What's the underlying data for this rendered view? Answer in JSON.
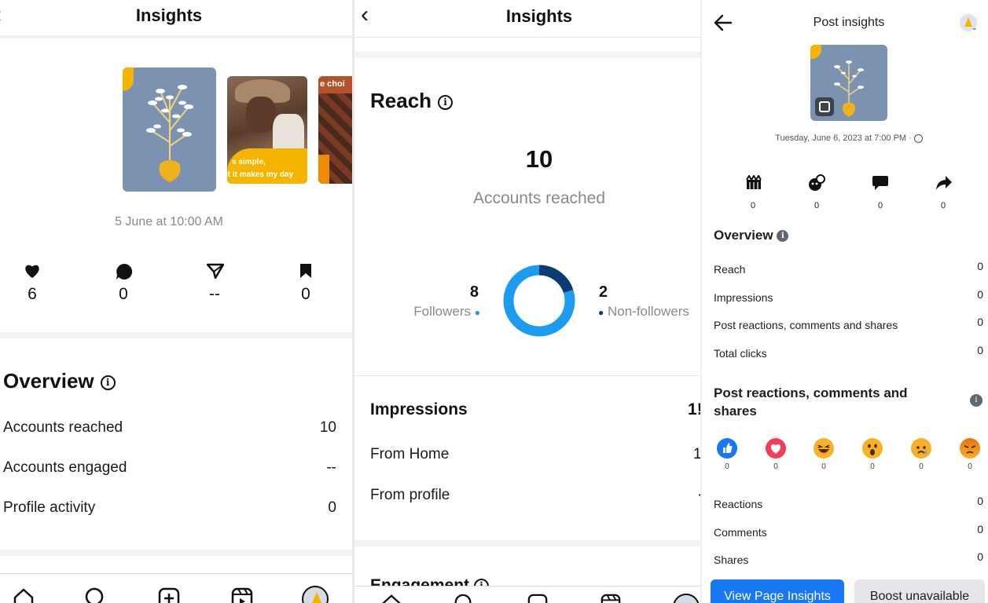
{
  "panel1": {
    "title": "Insights",
    "thumb_text_1": "e choi",
    "thumb_text_2": "s simple,",
    "thumb_text_3": "it it makes my day",
    "date": "5 June at 10:00 AM",
    "stats": [
      {
        "icon": "heart-icon",
        "value": "6"
      },
      {
        "icon": "comment-icon",
        "value": "0"
      },
      {
        "icon": "send-icon",
        "value": "--"
      },
      {
        "icon": "bookmark-icon",
        "value": "0"
      }
    ],
    "overview_title": "Overview",
    "rows": [
      {
        "label": "Accounts reached",
        "value": "10"
      },
      {
        "label": "Accounts engaged",
        "value": "--"
      },
      {
        "label": "Profile activity",
        "value": "0"
      }
    ],
    "nav": [
      "home-icon",
      "search-icon",
      "create-icon",
      "reels-icon",
      "profile-avatar"
    ]
  },
  "panel2": {
    "title": "Insights",
    "reach_title": "Reach",
    "reach_value": "10",
    "reach_caption": "Accounts reached",
    "followers_value": "8",
    "followers_label": "Followers",
    "nonfollowers_value": "2",
    "nonfollowers_label": "Non-followers",
    "donut": {
      "followers": 8,
      "nonfollowers": 2,
      "followers_color": "#1d9bf0",
      "nonfollowers_color": "#0c3a73"
    },
    "impressions_title": "Impressions",
    "impressions_value": "1!",
    "impr_rows": [
      {
        "label": "From Home",
        "value": "1"
      },
      {
        "label": "From profile",
        "value": "·"
      }
    ],
    "engagement_title": "Engagement"
  },
  "panel3": {
    "title": "Post insights",
    "date": "Tuesday, June 6, 2023 at 7:00 PM · ",
    "actions": [
      {
        "icon": "people-reached-icon",
        "value": "0"
      },
      {
        "icon": "reactions-icon",
        "value": "0"
      },
      {
        "icon": "comment-icon",
        "value": "0"
      },
      {
        "icon": "share-icon",
        "value": "0"
      }
    ],
    "overview_title": "Overview",
    "overview_rows": [
      {
        "label": "Reach",
        "value": "0"
      },
      {
        "label": "Impressions",
        "value": "0"
      },
      {
        "label": "Post reactions, comments and shares",
        "value": "0"
      },
      {
        "label": "Total clicks",
        "value": "0"
      }
    ],
    "reactions_title": "Post reactions, comments and shares",
    "reactions": [
      {
        "icon": "like-reaction-icon",
        "value": "0",
        "color": "#1877f2"
      },
      {
        "icon": "love-reaction-icon",
        "value": "0",
        "color": "#f33e58"
      },
      {
        "icon": "haha-reaction-icon",
        "value": "0",
        "color": "#f7b125"
      },
      {
        "icon": "wow-reaction-icon",
        "value": "0",
        "color": "#f7b125"
      },
      {
        "icon": "sad-reaction-icon",
        "value": "0",
        "color": "#f7b125"
      },
      {
        "icon": "angry-reaction-icon",
        "value": "0",
        "color": "#e9710f"
      }
    ],
    "detail_rows": [
      {
        "label": "Reactions",
        "value": "0"
      },
      {
        "label": "Comments",
        "value": "0"
      },
      {
        "label": "Shares",
        "value": "0"
      }
    ],
    "btn_primary": "View Page Insights",
    "btn_secondary": "Boost unavailable",
    "accent": "#1877f2"
  }
}
